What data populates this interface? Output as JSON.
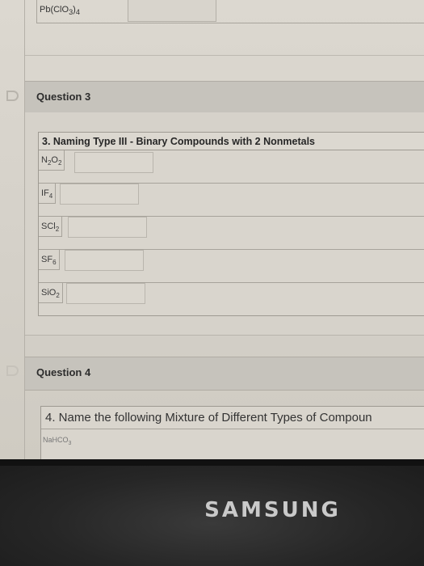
{
  "previous_question": {
    "formula_html": "Pb(ClO<sub>3</sub>)<sub>4</sub>"
  },
  "question3": {
    "title": "Question 3",
    "table_header": "3. Naming Type III - Binary Compounds with 2 Nonmetals",
    "rows": [
      {
        "formula_html": "N<sub>2</sub>O<sub>2</sub>",
        "answer": ""
      },
      {
        "formula_html": "IF<sub>4</sub>",
        "answer": ""
      },
      {
        "formula_html": "SCl<sub>2</sub>",
        "answer": ""
      },
      {
        "formula_html": "SF<sub>6</sub>",
        "answer": ""
      },
      {
        "formula_html": "SiO<sub>2</sub>",
        "answer": ""
      }
    ]
  },
  "question4": {
    "title": "Question 4",
    "table_header": "4. Name the following Mixture of Different Types of Compoun",
    "first_formula_html": "NaHCO<sub>3</sub>"
  },
  "bezel": {
    "brand": "SAMSUNG"
  },
  "colors": {
    "page": "#d6d2ca",
    "header": "#c6c3bc",
    "bezel": "#262626"
  }
}
